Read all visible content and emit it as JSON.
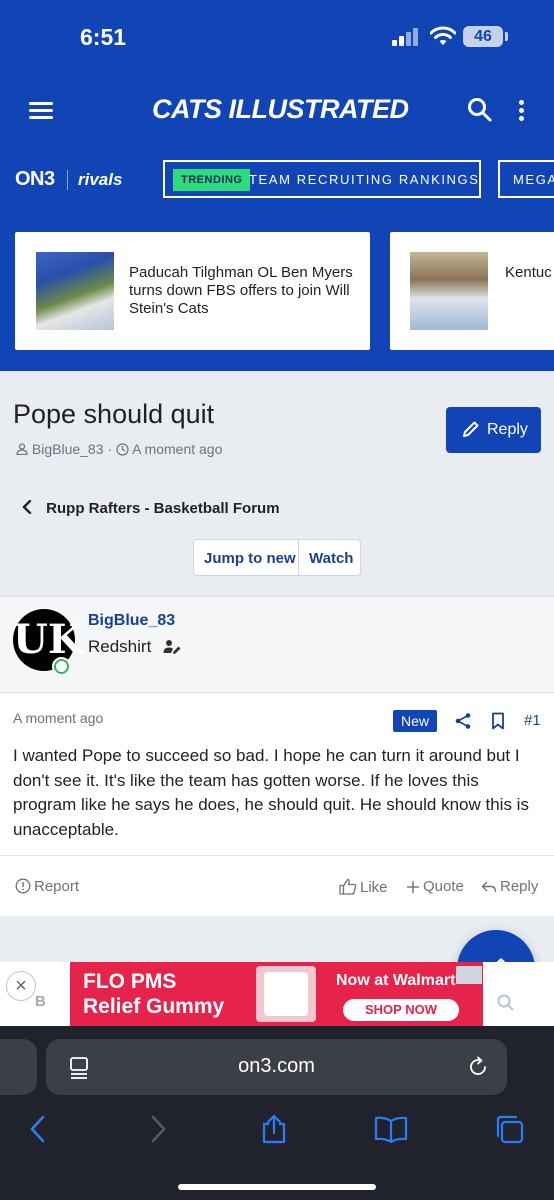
{
  "status_bar": {
    "time": "6:51",
    "battery": "46"
  },
  "header": {
    "brand": "CATS ILLUSTRATED",
    "on3": "ON3",
    "rivals": "rivals",
    "trending_tag": "TRENDING",
    "trending_text": "TEAM RECRUITING RANKINGS",
    "next_nav": "MEGA"
  },
  "headlines": [
    {
      "title": "Paducah Tilghman OL Ben Myers turns down FBS offers to join Will Stein's Cats"
    },
    {
      "title": "Kentuc commit Kenny I"
    }
  ],
  "thread": {
    "title": "Pope should quit",
    "author": "BigBlue_83",
    "time": "A moment ago",
    "reply_label": "Reply",
    "breadcrumb": "Rupp Rafters - Basketball Forum",
    "jump_label": "Jump to new",
    "watch_label": "Watch"
  },
  "post": {
    "avatar_text": "UK",
    "username": "BigBlue_83",
    "rank": "Redshirt",
    "time": "A moment ago",
    "badge": "New",
    "number": "#1",
    "body": "I wanted Pope to succeed so bad. I hope he can turn it around but I don't see it. It's like the team has gotten worse. If he loves this program like he says he does, he should quit. He should know this is unacceptable.",
    "actions": {
      "report": "Report",
      "like": "Like",
      "quote": "Quote",
      "reply": "Reply"
    }
  },
  "ad": {
    "line1": "FLO PMS",
    "line2": "Relief Gummy",
    "walmart": "Now at Walmart",
    "cta": "SHOP NOW",
    "left_letter": "B"
  },
  "browser": {
    "url": "on3.com"
  },
  "colors": {
    "brand_blue": "#1144b5",
    "link_blue": "#1c3f8f",
    "trending_green": "#2ddc7a",
    "ad_red": "#e6234a"
  }
}
